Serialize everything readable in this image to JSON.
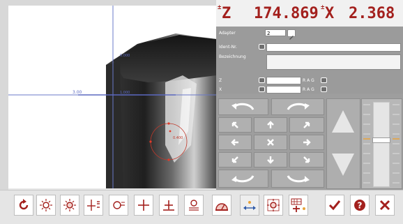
{
  "readout": {
    "z_symbol": "±",
    "z_letter": "Z",
    "z_value": "174.869",
    "x_symbol": "±",
    "x_letter": "X",
    "x_value": "2.368"
  },
  "form": {
    "adapter_label": "Adapter",
    "adapter_value": "2",
    "ident_label": "Ident-Nr.",
    "ident_value": "",
    "bezeichnung_label": "Bezeichnung",
    "bezeichnung_value": "",
    "z_label": "Z",
    "z_unit": "R A G",
    "x_label": "X",
    "x_unit": "R A G"
  },
  "camera": {
    "mark_z_label": "0.000",
    "mark_x_label": "3.00",
    "mark_r_label": "1.000",
    "mark_r2_label": "0.400"
  },
  "colors": {
    "accent": "#a3201d",
    "panel": "#9e9e9e",
    "button": "#b0b0b0"
  },
  "icons": {
    "toolbar": [
      "rotate-icon",
      "sun-icon",
      "sun-icon",
      "crosshair-offset-icon",
      "circle-measure-icon",
      "crosshair-icon",
      "tool-align-icon",
      "probe-icon",
      "dial-icon",
      "move-center-icon",
      "light-icon",
      "add-table-icon",
      "check-icon",
      "help-icon",
      "close-icon"
    ]
  }
}
